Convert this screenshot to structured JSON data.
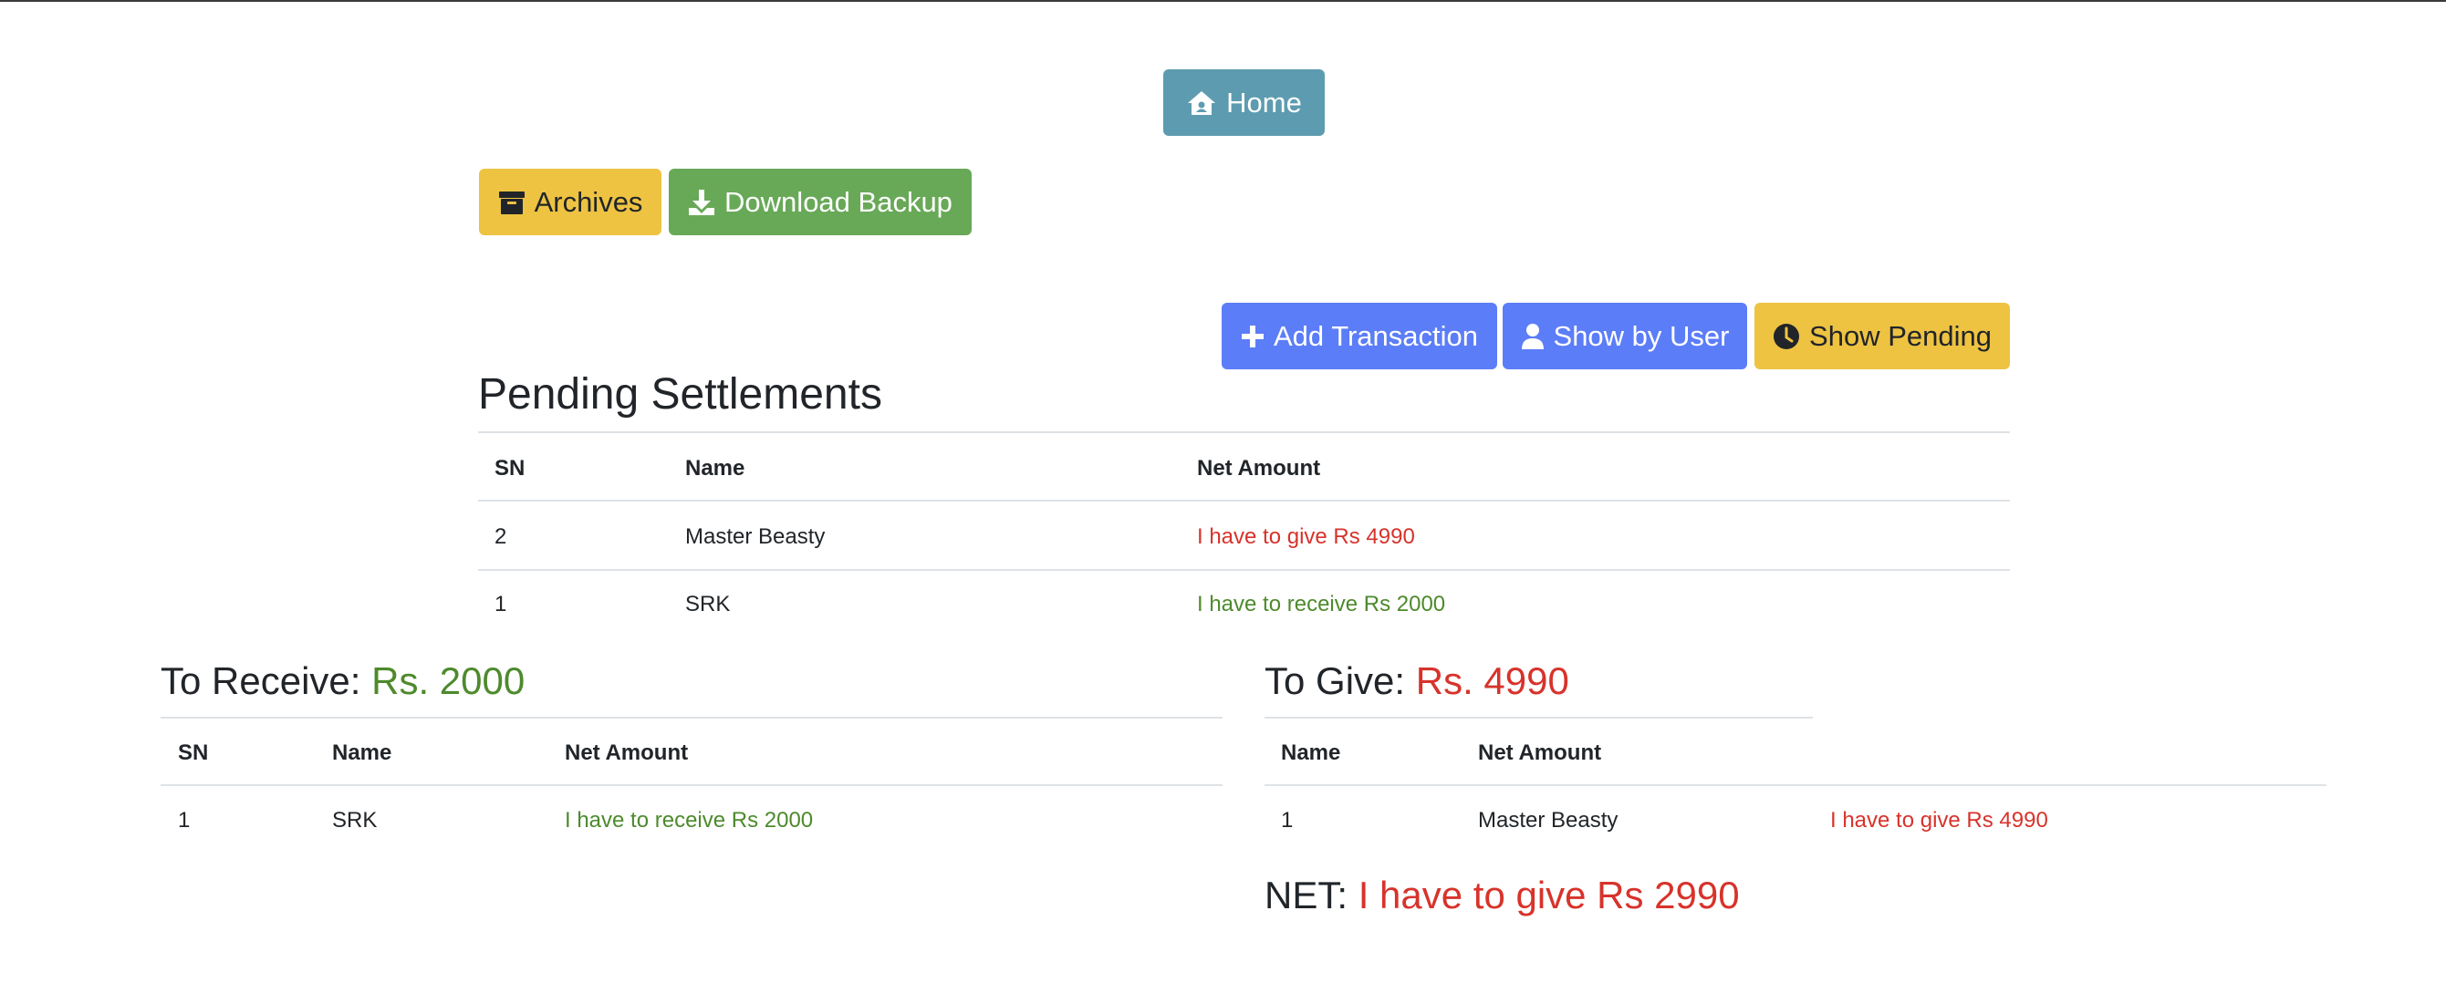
{
  "nav": {
    "home_label": "Home"
  },
  "toolbar": {
    "archives_label": "Archives",
    "download_label": "Download Backup"
  },
  "actions": {
    "add_label": "Add Transaction",
    "by_user_label": "Show by User",
    "pending_label": "Show Pending"
  },
  "pending": {
    "title": "Pending Settlements",
    "headers": [
      "SN",
      "Name",
      "Net Amount"
    ],
    "rows": [
      {
        "sn": "2",
        "name": "Master Beasty",
        "amount": "I have to give Rs 4990"
      },
      {
        "sn": "1",
        "name": "SRK",
        "amount": "I have to receive Rs 2000"
      }
    ]
  },
  "receive": {
    "label": "To Receive:",
    "total": "Rs. 2000",
    "headers": [
      "SN",
      "Name",
      "Net Amount"
    ],
    "rows": [
      {
        "sn": "1",
        "name": "SRK",
        "amount": "I have to receive Rs 2000"
      }
    ]
  },
  "give": {
    "label": "To Give:",
    "total": "Rs. 4990",
    "headers": [
      "Name",
      "Net Amount"
    ],
    "rows": [
      {
        "sn": "1",
        "name": "Master Beasty",
        "amount": "I have to give Rs 4990"
      }
    ]
  },
  "net": {
    "label": "NET:",
    "value": "I have to give Rs 2990"
  },
  "colors": {
    "primary": "#5c7df8",
    "warning": "#eec342",
    "success": "#68a957",
    "info": "#5d9cb0",
    "positive": "#4d8a2c",
    "negative": "#d7332b"
  }
}
